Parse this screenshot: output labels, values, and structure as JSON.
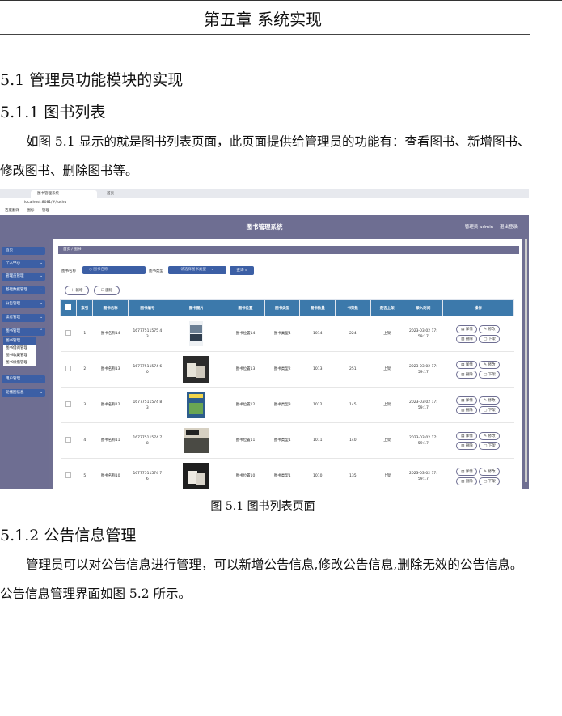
{
  "chapter_title": "第五章 系统实现",
  "section_5_1": "5.1 管理员功能模块的实现",
  "section_5_1_1": "5.1.1 图书列表",
  "para_1": "如图 5.1 显示的就是图书列表页面，此页面提供给管理员的功能有：查看图书、新增图书、修改图书、删除图书等。",
  "figure_caption": "图 5.1 图书列表页面",
  "section_5_1_2": "5.1.2 公告信息管理",
  "para_2": "管理员可以对公告信息进行管理，可以新增公告信息,修改公告信息,删除无效的公告信息。公告信息管理界面如图 5.2 所示。",
  "screenshot": {
    "browser": {
      "tab1": "图书管理系统",
      "tab2": "首页",
      "url": "localhost:8081/#/luchu",
      "bookmarks": [
        "百度翻译",
        "图标",
        "管理"
      ]
    },
    "app_title": "图书管理系统",
    "user_info": "管理员 admin",
    "logout": "退出登录",
    "sidebar": [
      "首页",
      "个人中心",
      "管理员管理",
      "基础数据管理",
      "公告管理",
      "读者管理",
      "图书管理"
    ],
    "sidebar_sub": [
      "图书管理",
      "图书借阅管理",
      "图书收藏管理",
      "图书续借管理"
    ],
    "sidebar_after": [
      "用户管理",
      "轮播图信息"
    ],
    "breadcrumb": "首页 / 图书",
    "filter": {
      "name_label": "图书名称",
      "name_placeholder": "图书名称",
      "type_label": "图书类型",
      "type_placeholder": "请选择图书类型",
      "search_label": "查询"
    },
    "add_label": "＋ 新增",
    "delete_label": "删除",
    "columns": [
      "索引",
      "图书名称",
      "图书编号",
      "图书图片",
      "图书位置",
      "图书类型",
      "图书数量",
      "书架数",
      "是否上架",
      "录入时间",
      "操作"
    ],
    "actions": [
      "详情",
      "修改",
      "删除",
      "下架"
    ],
    "rows": [
      {
        "idx": "1",
        "name": "图书名称14",
        "code1": "16777511575 4",
        "code2": "3",
        "loc": "图书位置14",
        "type": "图书类型4",
        "qty": "1014",
        "shelf": "224",
        "status": "上架",
        "time1": "2023-03-02 17:",
        "time2": "59:17"
      },
      {
        "idx": "2",
        "name": "图书名称13",
        "code1": "16777511574 6",
        "code2": "0",
        "loc": "图书位置13",
        "type": "图书类型2",
        "qty": "1013",
        "shelf": "251",
        "status": "上架",
        "time1": "2023-03-02 17:",
        "time2": "59:17"
      },
      {
        "idx": "3",
        "name": "图书名称12",
        "code1": "16777511574 8",
        "code2": "3",
        "loc": "图书位置12",
        "type": "图书类型3",
        "qty": "1012",
        "shelf": "145",
        "status": "上架",
        "time1": "2023-03-02 17:",
        "time2": "59:17"
      },
      {
        "idx": "4",
        "name": "图书名称11",
        "code1": "16777511574 7",
        "code2": "8",
        "loc": "图书位置11",
        "type": "图书类型1",
        "qty": "1011",
        "shelf": "140",
        "status": "上架",
        "time1": "2023-03-02 17:",
        "time2": "59:17"
      },
      {
        "idx": "5",
        "name": "图书名称10",
        "code1": "16777511574 7",
        "code2": "6",
        "loc": "图书位置10",
        "type": "图书类型1",
        "qty": "1010",
        "shelf": "135",
        "status": "上架",
        "time1": "2023-03-02 17:",
        "time2": "59:17"
      }
    ]
  }
}
